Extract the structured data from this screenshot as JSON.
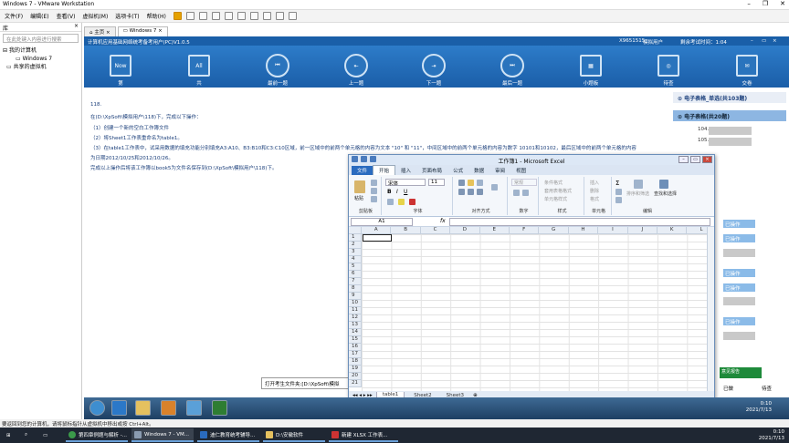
{
  "vmware": {
    "title": "Windows 7 - VMware Workstation",
    "menu": [
      "文件(F)",
      "编辑(E)",
      "查看(V)",
      "虚拟机(M)",
      "选项卡(T)",
      "帮助(H)"
    ],
    "library": {
      "header": "库",
      "search_placeholder": "在此处键入内容进行搜索",
      "tree": [
        "我的计算机",
        "Windows 7",
        "共享的虚拟机"
      ]
    },
    "tabs": [
      "主页",
      "Windows 7"
    ]
  },
  "exam": {
    "app_title": "计算机应用基础网络统考备考用户(PC)V1.0.5",
    "user_id": "X9651515",
    "user_label": "模拟用户",
    "time_left": "剩余考试时间：1:04",
    "toolbar": [
      {
        "label": "第",
        "top": "Now",
        "icon": "now-icon"
      },
      {
        "label": "共",
        "top": "All",
        "icon": "all-icon"
      },
      {
        "label": "最前一题",
        "icon": "first-icon"
      },
      {
        "label": "上一题",
        "icon": "prev-icon"
      },
      {
        "label": "下一题",
        "icon": "next-icon"
      },
      {
        "label": "最后一题",
        "icon": "last-icon"
      },
      {
        "label": "小题板",
        "icon": "board-icon"
      },
      {
        "label": "待查",
        "icon": "review-icon"
      },
      {
        "label": "交卷",
        "icon": "submit-icon"
      }
    ],
    "question": {
      "number": "118.",
      "lines": [
        "在(D:\\XpSoft\\模拟用户\\118)下，完成以下操作：",
        "（1）创建一个新的空白工作簿文件",
        "（2）将Sheet1工作表重命名为table1。",
        "（3）在table1工作表中，试采用数据的填充功能分别填充A3:A10、B3:B10和C3:C10区域，前一区域中的前两个单元格的内容为文本 \"10\" 和 \"11\"，中间区域中的前两个单元格的内容为数字 10101和10102，最后区域中的前两个单元格的内容",
        "为日期2012/10/25和2012/10/26。",
        "完成以上操作后将该工作簿以book5为文件名保存到(D:\\XpSoft\\模拟用户\\118)下。"
      ]
    },
    "open_folder": "打开考生文件夹:[D:\\XpSoft\\模拟",
    "right_panel": {
      "cat1": "电子表格_单选(共103题)",
      "cat2": "电子表格(共20题)",
      "numbers": [
        "104.",
        "105."
      ],
      "done_label": "已操作",
      "green_btn": "意见报告",
      "bottom": [
        "已做",
        "待查"
      ]
    }
  },
  "excel": {
    "title": "工作簿1 - Microsoft Excel",
    "tabs": [
      "文件",
      "开始",
      "插入",
      "页面布局",
      "公式",
      "数据",
      "审阅",
      "视图"
    ],
    "groups": {
      "clipboard": "剪贴板",
      "font": "字体",
      "align": "对齐方式",
      "number": "数字",
      "style": "样式",
      "cells": "单元格",
      "editing": "编辑"
    },
    "font_name": "宋体",
    "font_size": "11",
    "number_format": "常规",
    "paste_label": "粘贴",
    "style_items": [
      "条件格式",
      "套用表格格式",
      "单元格样式"
    ],
    "cells_items": [
      "插入",
      "删除",
      "格式"
    ],
    "edit_items": [
      "排序和筛选",
      "查找和选择"
    ],
    "name_box": "A1",
    "fx": "fx",
    "columns": [
      "A",
      "B",
      "C",
      "D",
      "E",
      "F",
      "G",
      "H",
      "I",
      "J",
      "K",
      "L"
    ],
    "rows": [
      "1",
      "2",
      "3",
      "4",
      "5",
      "6",
      "7",
      "8",
      "9",
      "10",
      "11",
      "12",
      "13",
      "14",
      "15",
      "16",
      "17",
      "18",
      "19",
      "20",
      "21"
    ],
    "sheets": [
      "table1",
      "Sheet2",
      "Sheet3"
    ]
  },
  "vm_clock": {
    "time": "0:10",
    "date": "2021/7/13"
  },
  "vm_statusbar": "要返回到您的计算机，请将鼠标指针从虚拟机中移出或按 Ctrl+Alt。",
  "host_taskbar": {
    "items": [
      "第四章例题与解析 -...",
      "Windows 7 - VM...",
      "迪仁教育统考辅导...",
      "D:\\安徽软件",
      "新建 XLSX 工作表..."
    ],
    "time": "0:10",
    "date": "2021/7/13"
  }
}
